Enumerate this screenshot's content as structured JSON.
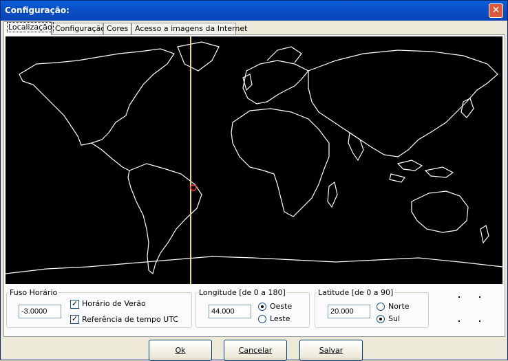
{
  "window": {
    "title": "Configuração:",
    "close_glyph": "✕"
  },
  "tabs": [
    {
      "label": "Localização",
      "active": true
    },
    {
      "label": "Configuração",
      "active": false
    },
    {
      "label": "Cores",
      "active": false
    },
    {
      "label": "Acesso a imagens da Internet",
      "active": false
    }
  ],
  "map": {
    "icon": "world-map",
    "marker_color": "#ff3333",
    "meridian_color": "#e8d890"
  },
  "timezone": {
    "legend": "Fuso Horário",
    "value": "-3.0000",
    "dst_label": "Horário de Verão",
    "dst_checked": true,
    "utc_label": "Referência de tempo UTC",
    "utc_checked": true
  },
  "longitude": {
    "legend": "Longitude [de 0 a 180]",
    "value": "44.000",
    "west_label": "Oeste",
    "east_label": "Leste",
    "selected": "Oeste"
  },
  "latitude": {
    "legend": "Latitude [de 0 a 90]",
    "value": "20.000",
    "north_label": "Norte",
    "south_label": "Sul",
    "selected": "Sul"
  },
  "buttons": {
    "ok": "Ok",
    "cancel": "Cancelar",
    "save": "Salvar"
  }
}
